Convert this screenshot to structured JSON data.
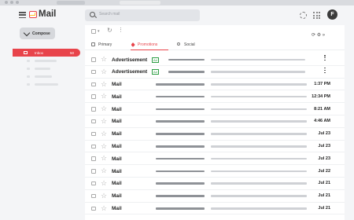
{
  "app": {
    "name": "Mail"
  },
  "search": {
    "placeholder": "Search mail"
  },
  "user": {
    "initial": "F"
  },
  "sidebar": {
    "compose_label": "Compose",
    "inbox_label": "Inbox",
    "inbox_count": "50"
  },
  "tabs": [
    {
      "label": "Primary",
      "active": false
    },
    {
      "label": "Promotions",
      "active": true
    },
    {
      "label": "Social",
      "active": false
    }
  ],
  "colors": {
    "accent": "#e8444b",
    "ad_badge": "#2e9e44",
    "logo_yellow": "#ffbf26"
  },
  "messages": [
    {
      "sender": "Advertisement",
      "badge": "Ad",
      "date": ""
    },
    {
      "sender": "Advertisement",
      "badge": "Ad",
      "date": ""
    },
    {
      "sender": "Mail",
      "date": "1:37 PM"
    },
    {
      "sender": "Mail",
      "date": "12:34 PM"
    },
    {
      "sender": "Mail",
      "date": "8:21 AM"
    },
    {
      "sender": "Mail",
      "date": "4:46 AM"
    },
    {
      "sender": "Mail",
      "date": "Jul 23"
    },
    {
      "sender": "Mail",
      "date": "Jul 23"
    },
    {
      "sender": "Mail",
      "date": "Jul 23"
    },
    {
      "sender": "Mail",
      "date": "Jul 22"
    },
    {
      "sender": "Mail",
      "date": "Jul 21"
    },
    {
      "sender": "Mail",
      "date": "Jul 21"
    },
    {
      "sender": "Mail",
      "date": "Jul 21"
    }
  ]
}
